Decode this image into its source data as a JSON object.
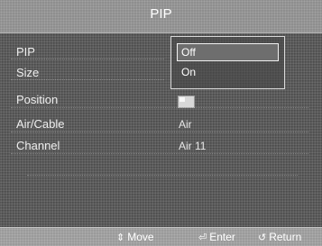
{
  "header": {
    "title": "PIP"
  },
  "menu": {
    "items": [
      {
        "label": "PIP",
        "value": ""
      },
      {
        "label": "Size",
        "value": ""
      },
      {
        "label": "Position",
        "value": ""
      },
      {
        "label": "Air/Cable",
        "value": "Air"
      },
      {
        "label": "Channel",
        "value": "Air 11"
      }
    ]
  },
  "dropdown": {
    "options": [
      "Off",
      "On"
    ],
    "selected": "Off"
  },
  "footer": {
    "move": {
      "icon": "updown-arrows-icon",
      "label": "Move"
    },
    "enter": {
      "icon": "enter-icon",
      "label": "Enter"
    },
    "return": {
      "icon": "return-icon",
      "label": "Return"
    }
  }
}
